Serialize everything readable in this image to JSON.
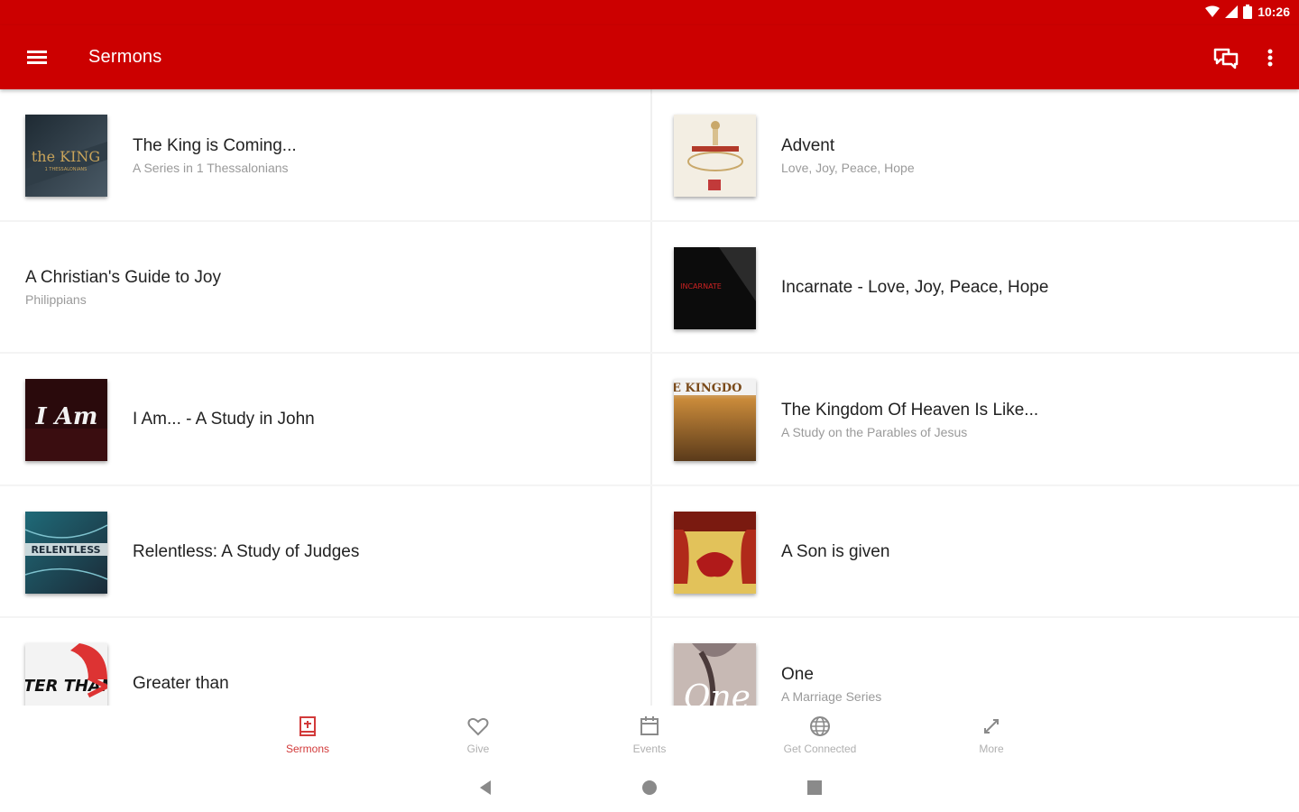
{
  "status_bar": {
    "time": "10:26"
  },
  "app_bar": {
    "title": "Sermons"
  },
  "sermons_left": [
    {
      "title": "The King is Coming...",
      "subtitle": "A Series in 1 Thessalonians",
      "thumb_text": "the KING",
      "thumb_subtext": "1 THESSALONIANS"
    },
    {
      "title": "A Christian's Guide to Joy",
      "subtitle": "Philippians"
    },
    {
      "title": "I Am... - A Study in John",
      "thumb_text": "I Am"
    },
    {
      "title": "Relentless:  A Study of Judges",
      "thumb_text": "RELENTLESS"
    },
    {
      "title": "Greater than",
      "thumb_text": "TER THAN"
    }
  ],
  "sermons_right": [
    {
      "title": "Advent",
      "subtitle": "Love, Joy, Peace, Hope"
    },
    {
      "title": "Incarnate - Love, Joy, Peace, Hope",
      "thumb_text": "INCARNATE"
    },
    {
      "title": "The Kingdom Of Heaven Is Like...",
      "subtitle": "A Study on the Parables of Jesus",
      "thumb_text": "E KINGDO"
    },
    {
      "title": "A Son is given"
    },
    {
      "title": "One",
      "subtitle": "A Marriage Series",
      "thumb_text": "One"
    }
  ],
  "bottom_nav": [
    {
      "label": "Sermons",
      "icon": "book-icon",
      "active": true
    },
    {
      "label": "Give",
      "icon": "heart-icon",
      "active": false
    },
    {
      "label": "Events",
      "icon": "calendar-icon",
      "active": false
    },
    {
      "label": "Get Connected",
      "icon": "globe-icon",
      "active": false
    },
    {
      "label": "More",
      "icon": "more-icon",
      "active": false
    }
  ],
  "colors": {
    "primary": "#cc0000",
    "active_nav": "#d23a3a",
    "inactive_nav": "#b0b0b0"
  }
}
